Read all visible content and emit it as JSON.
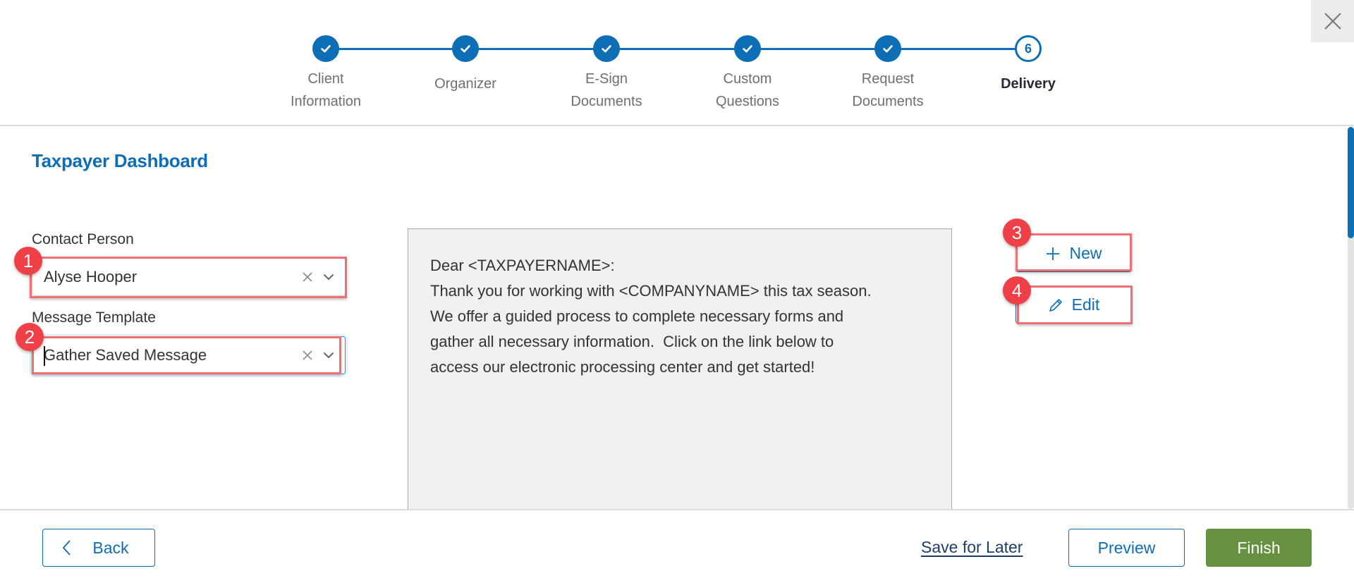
{
  "window": {
    "close_icon": "close-x-icon"
  },
  "stepper": {
    "steps": [
      {
        "line1": "Client",
        "line2": "Information",
        "status": "completed",
        "icon": "check-icon"
      },
      {
        "line1": "Organizer",
        "line2": "",
        "status": "completed",
        "icon": "check-icon"
      },
      {
        "line1": "E-Sign",
        "line2": "Documents",
        "status": "completed",
        "icon": "check-icon"
      },
      {
        "line1": "Custom",
        "line2": "Questions",
        "status": "completed",
        "icon": "check-icon"
      },
      {
        "line1": "Request",
        "line2": "Documents",
        "status": "completed",
        "icon": "check-icon"
      },
      {
        "line1": "Delivery",
        "line2": "",
        "status": "current",
        "number": "6"
      }
    ],
    "accent_color": "#0d6db5"
  },
  "page": {
    "title": "Taxpayer Dashboard"
  },
  "form": {
    "contact_person": {
      "label": "Contact Person",
      "value": "Alyse Hooper"
    },
    "message_template": {
      "label": "Message Template",
      "value": "Gather Saved Message"
    }
  },
  "message": {
    "lines": [
      "Dear <TAXPAYERNAME>:",
      "Thank you for working with <COMPANYNAME> this tax season.",
      "We offer a guided process to complete necessary forms and",
      "gather all necessary information.  Click on the link below to",
      "access our electronic processing center and get started!"
    ]
  },
  "template_actions": {
    "new_label": "New",
    "edit_label": "Edit"
  },
  "annotations": {
    "badges": [
      "1",
      "2",
      "3",
      "4"
    ],
    "color": "#ef4047"
  },
  "footer": {
    "back_label": "Back",
    "save_later_label": "Save for Later",
    "preview_label": "Preview",
    "finish_label": "Finish",
    "finish_color": "#669140"
  }
}
